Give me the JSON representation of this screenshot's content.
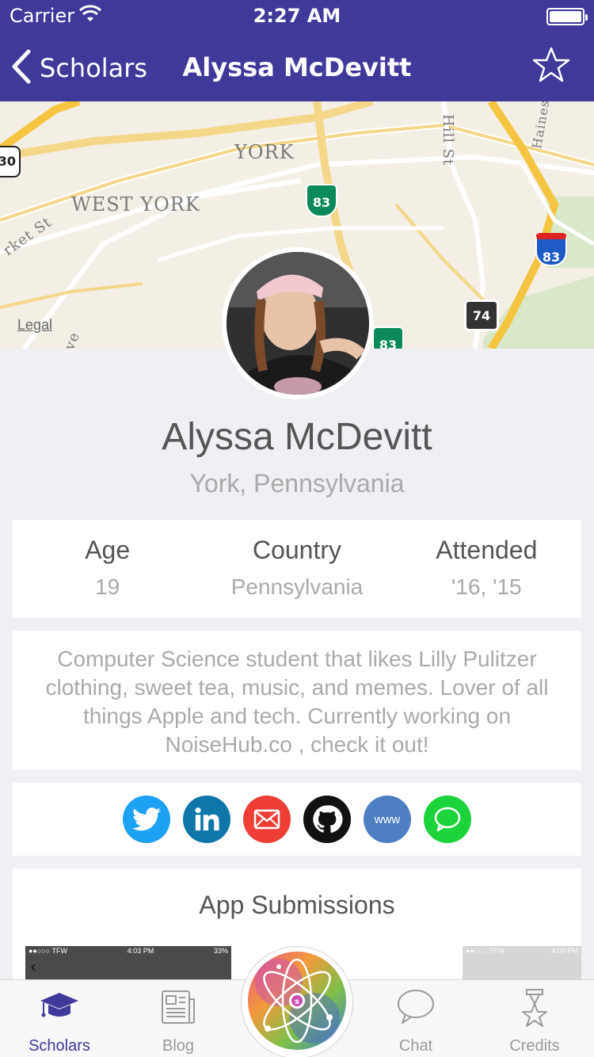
{
  "status_bar": {
    "carrier": "Carrier",
    "time": "2:27 AM"
  },
  "nav": {
    "back_label": "Scholars",
    "title": "Alyssa McDevitt"
  },
  "map": {
    "labels": {
      "york": "YORK",
      "west_york": "WEST YORK",
      "hill_st": "Hill St",
      "haines": "Haines",
      "market_st": "rket St",
      "ve": "ve"
    },
    "shields": {
      "i83_a": "83",
      "i83_b": "83",
      "i83_c": "83",
      "r74": "74",
      "r30": "30"
    },
    "legal": "Legal"
  },
  "profile": {
    "name": "Alyssa McDevitt",
    "location": "York, Pennsylvania",
    "stats": [
      {
        "label": "Age",
        "value": "19"
      },
      {
        "label": "Country",
        "value": "Pennsylvania"
      },
      {
        "label": "Attended",
        "value": "'16, '15"
      }
    ],
    "bio": "Computer Science student that likes Lilly Pulitzer clothing, sweet tea, music, and memes. Lover of all things Apple and tech. Currently working on NoiseHub.co , check it out!"
  },
  "socials": [
    {
      "name": "twitter",
      "color": "#1da1f2"
    },
    {
      "name": "linkedin",
      "color": "#0e76a8"
    },
    {
      "name": "email",
      "color": "#ef3e36"
    },
    {
      "name": "github",
      "color": "#111111"
    },
    {
      "name": "website",
      "color": "#4e7fc2",
      "label": "www"
    },
    {
      "name": "imessage",
      "color": "#1dd33b"
    }
  ],
  "apps": {
    "heading": "App Submissions",
    "shot_left": {
      "carrier": "●●○○○ TFW",
      "time": "4:03 PM",
      "battery": "33%"
    },
    "shot_right": {
      "carrier": "●●○○○ TFW",
      "time": "4:03 PM"
    }
  },
  "tabs": [
    {
      "label": "Scholars",
      "active": true
    },
    {
      "label": "Blog",
      "active": false
    },
    {
      "label": "Chat",
      "active": false
    },
    {
      "label": "Credits",
      "active": false
    }
  ],
  "colors": {
    "brand": "#3f3a9a",
    "background": "#efeff4",
    "active_tab": "#3f3a9a"
  }
}
